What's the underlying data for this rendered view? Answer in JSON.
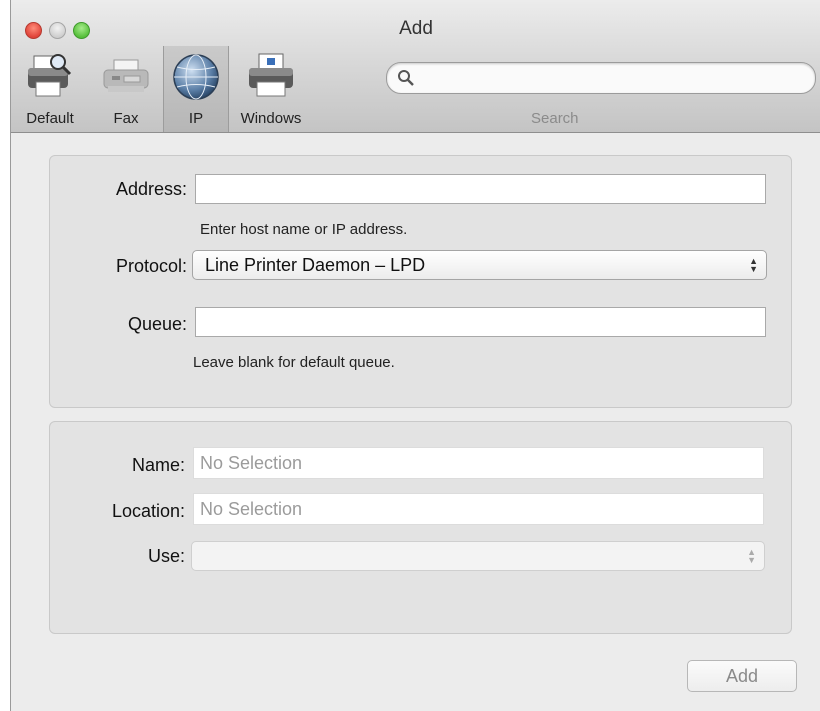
{
  "window": {
    "title": "Add"
  },
  "toolbar": {
    "items": [
      {
        "label": "Default",
        "icon": "printer-search-icon"
      },
      {
        "label": "Fax",
        "icon": "fax-icon"
      },
      {
        "label": "IP",
        "icon": "globe-icon",
        "selected": true
      },
      {
        "label": "Windows",
        "icon": "windows-printer-icon"
      }
    ],
    "search": {
      "label": "Search",
      "value": ""
    }
  },
  "connection": {
    "address": {
      "label": "Address:",
      "value": "",
      "hint": "Enter host name or IP address."
    },
    "protocol": {
      "label": "Protocol:",
      "value": "Line Printer Daemon – LPD"
    },
    "queue": {
      "label": "Queue:",
      "value": "",
      "hint": "Leave blank for default queue."
    }
  },
  "printer_info": {
    "name": {
      "label": "Name:",
      "value": "No Selection"
    },
    "location": {
      "label": "Location:",
      "value": "No Selection"
    },
    "use": {
      "label": "Use:",
      "value": ""
    }
  },
  "footer": {
    "add_label": "Add"
  },
  "colors": {
    "close": "#e0443a",
    "minimize": "#cfcfcf",
    "zoom": "#58c03c"
  }
}
